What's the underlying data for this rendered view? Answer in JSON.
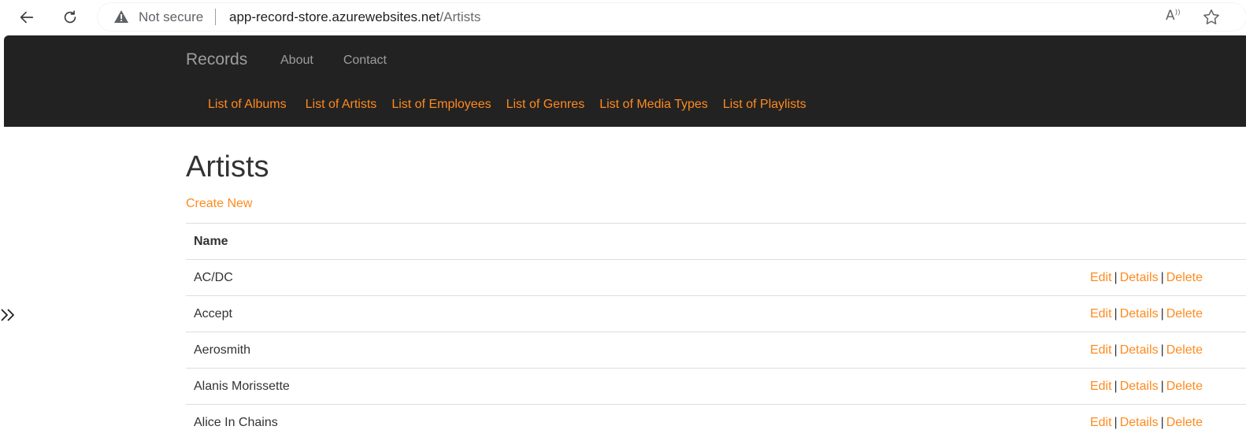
{
  "browser": {
    "security_label": "Not secure",
    "url_host": "app-record-store.azurewebsites.net",
    "url_path": "/Artists",
    "read_aloud_glyph": "A",
    "icons": [
      "back-arrow-icon",
      "refresh-icon",
      "warning-icon",
      "read-aloud-icon",
      "favorite-star-icon"
    ]
  },
  "navbar": {
    "brand": "Records",
    "links": [
      "About",
      "Contact"
    ],
    "sublinks": [
      "List of Albums",
      "List of Artists",
      "List of Employees",
      "List of Genres",
      "List of Media Types",
      "List of Playlists"
    ]
  },
  "main": {
    "title": "Artists",
    "create_new": "Create New",
    "table": {
      "header_name": "Name",
      "rows": [
        "AC/DC",
        "Accept",
        "Aerosmith",
        "Alanis Morissette",
        "Alice In Chains"
      ],
      "actions": {
        "edit": "Edit",
        "details": "Details",
        "delete": "Delete",
        "separator": "|"
      }
    }
  },
  "colors": {
    "navbar_bg": "#222222",
    "link_accent": "#ff8a1e",
    "brand_text": "#9d9d9d"
  }
}
